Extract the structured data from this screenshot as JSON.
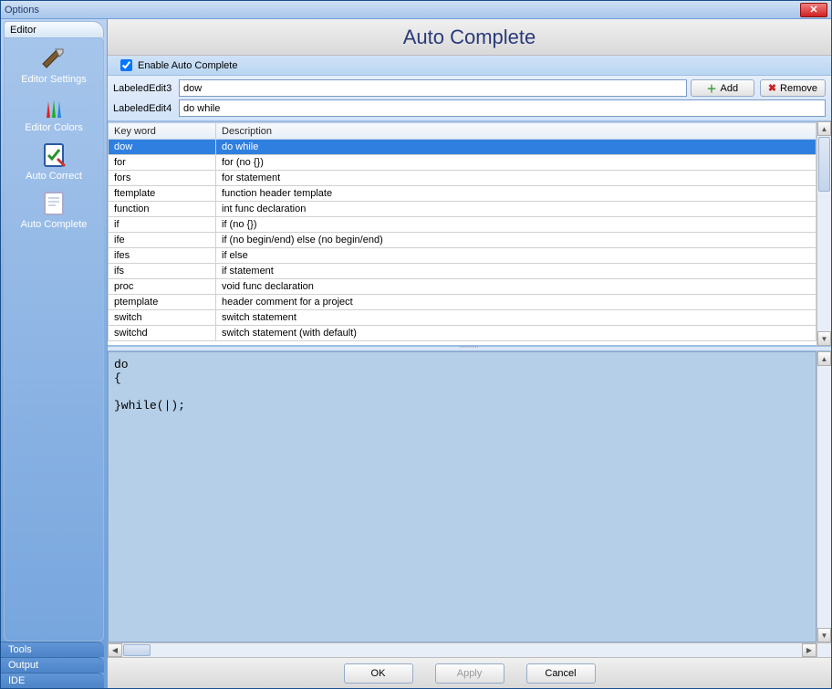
{
  "window": {
    "title": "Options"
  },
  "sidebar": {
    "activeTab": "Editor",
    "items": [
      {
        "label": "Editor Settings"
      },
      {
        "label": "Editor Colors"
      },
      {
        "label": "Auto Correct"
      },
      {
        "label": "Auto Complete"
      }
    ],
    "bottomTabs": [
      {
        "label": "Tools"
      },
      {
        "label": "Output"
      },
      {
        "label": "IDE"
      }
    ]
  },
  "page": {
    "title": "Auto Complete",
    "enableLabel": "Enable Auto Complete",
    "enableChecked": true,
    "edit3Label": "LabeledEdit3",
    "edit3Value": "dow",
    "edit4Label": "LabeledEdit4",
    "edit4Value": "do while",
    "addLabel": "Add",
    "removeLabel": "Remove"
  },
  "table": {
    "columns": [
      "Key word",
      "Description"
    ],
    "selectedIndex": 0,
    "rows": [
      {
        "key": "dow",
        "desc": "do while"
      },
      {
        "key": "for",
        "desc": "for (no {})"
      },
      {
        "key": "fors",
        "desc": "for statement"
      },
      {
        "key": "ftemplate",
        "desc": "function header template"
      },
      {
        "key": "function",
        "desc": "int func declaration"
      },
      {
        "key": "if",
        "desc": "if (no {})"
      },
      {
        "key": "ife",
        "desc": "if  (no begin/end) else (no begin/end)"
      },
      {
        "key": "ifes",
        "desc": "if  else"
      },
      {
        "key": "ifs",
        "desc": "if statement"
      },
      {
        "key": "proc",
        "desc": "void func declaration"
      },
      {
        "key": "ptemplate",
        "desc": "header comment for a project"
      },
      {
        "key": "switch",
        "desc": "switch statement"
      },
      {
        "key": "switchd",
        "desc": "switch statement (with default)"
      }
    ]
  },
  "code": "do\n{\n\n}while(|);",
  "buttons": {
    "ok": "OK",
    "apply": "Apply",
    "cancel": "Cancel"
  }
}
